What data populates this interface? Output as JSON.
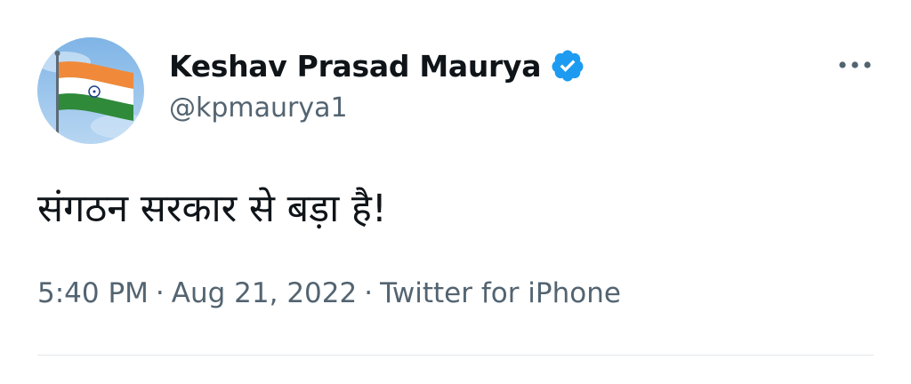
{
  "author": {
    "display_name": "Keshav Prasad Maurya",
    "handle": "@kpmaurya1",
    "avatar_icon": "india-flag-avatar",
    "verified_icon": "verified-badge-icon"
  },
  "tweet": {
    "text": "संगठन सरकार से बड़ा है!",
    "time": "5:40 PM",
    "date": "Aug 21, 2022",
    "separator": "·",
    "source": "Twitter for iPhone"
  },
  "actions": {
    "more_icon": "more-options-icon"
  },
  "colors": {
    "text_primary": "#0f1419",
    "text_secondary": "#536471",
    "verified_blue": "#1d9bf0",
    "divider": "#e3e7ea"
  }
}
